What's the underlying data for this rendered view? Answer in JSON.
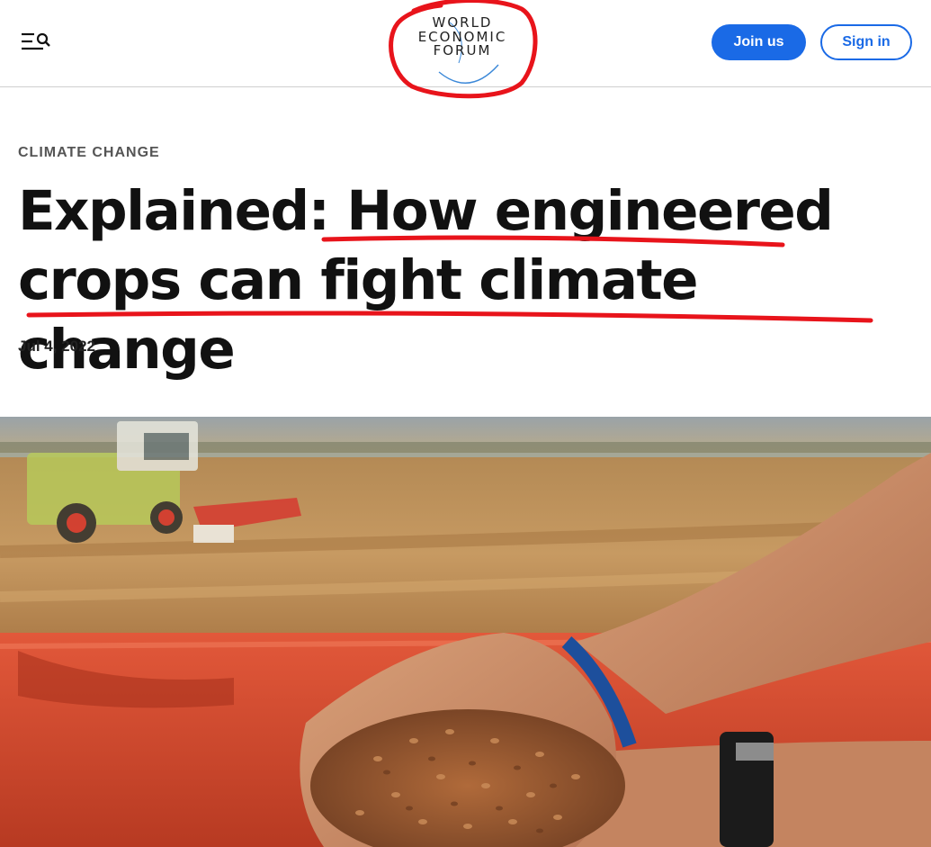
{
  "header": {
    "logo_lines": [
      "WORLD",
      "ECONOMIC",
      "FORUM"
    ],
    "join_label": "Join us",
    "signin_label": "Sign in"
  },
  "article": {
    "category": "CLIMATE CHANGE",
    "headline": "Explained: How engineered crops can fight climate change",
    "date": "Jul 4, 2022"
  },
  "colors": {
    "brand_blue": "#1a6ae6",
    "annotation_red": "#e8141b"
  },
  "icons": [
    "menu-icon",
    "search-icon"
  ]
}
